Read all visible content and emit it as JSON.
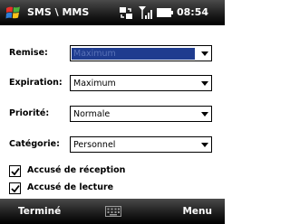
{
  "titlebar": {
    "title": "SMS \\ MMS",
    "time": "08:54",
    "icons": [
      "windows-start-icon",
      "connectivity-icon",
      "signal-strength-icon",
      "battery-icon"
    ]
  },
  "form": {
    "remise": {
      "label": "Remise:",
      "value": "Maximum"
    },
    "expiration": {
      "label": "Expiration:",
      "value": "Maximum"
    },
    "priorite": {
      "label": "Priorité:",
      "value": "Normale"
    },
    "categorie": {
      "label": "Catégorie:",
      "value": "Personnel"
    },
    "accuse_reception": {
      "label": "Accusé de réception",
      "checked": true
    },
    "accuse_lecture": {
      "label": "Accusé de lecture",
      "checked": true
    }
  },
  "softkeys": {
    "left": "Terminé",
    "right": "Menu",
    "center_icon": "keyboard-icon"
  },
  "colors": {
    "bar_dark": "#000000",
    "selection": "#1f3c8f",
    "windows_red": "#e8312a",
    "windows_green": "#4cb33a",
    "windows_blue": "#2f7fd6",
    "windows_yellow": "#f7c21a"
  }
}
